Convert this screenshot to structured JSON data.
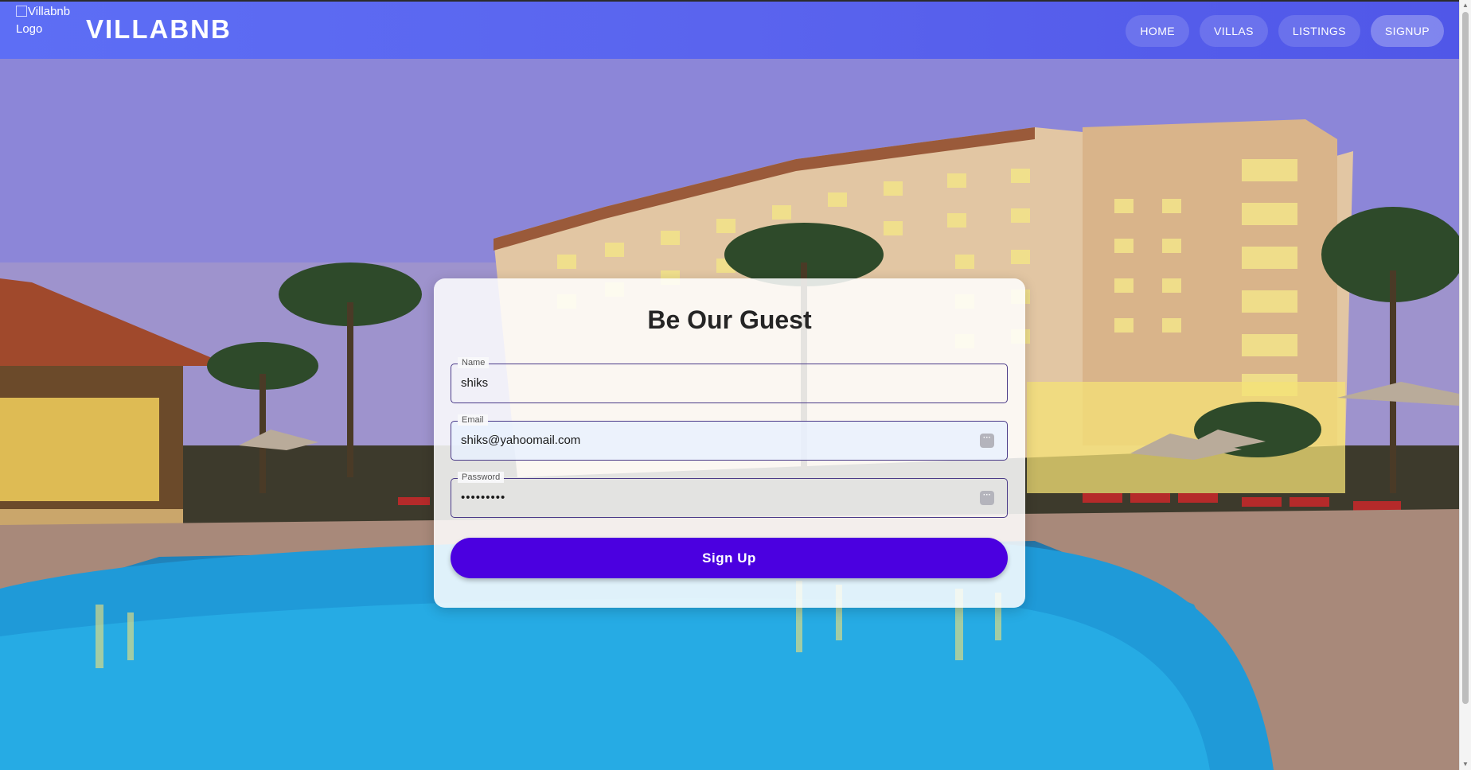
{
  "navbar": {
    "logo_alt": "Villabnb Logo",
    "brand": "VILLABNB",
    "links": [
      {
        "label": "HOME"
      },
      {
        "label": "VILLAS"
      },
      {
        "label": "LISTINGS"
      },
      {
        "label": "SIGNUP",
        "active": true
      }
    ]
  },
  "form": {
    "title": "Be Our Guest",
    "fields": {
      "name": {
        "label": "Name",
        "value": "shiks"
      },
      "email": {
        "label": "Email",
        "value": "shiks@yahoomail.com",
        "icon": "autofill-key-icon"
      },
      "password": {
        "label": "Password",
        "value": "•••••••••",
        "icon": "autofill-key-icon"
      }
    },
    "submit_label": "Sign Up"
  },
  "background": {
    "description_colors": {
      "sky": "#7d7fe0",
      "pool": "#2aa3d8",
      "building": "#e8c9a0"
    }
  },
  "colors": {
    "navbar": "#5a64ee",
    "submit": "#4b00e0",
    "field_border": "#4a3a88"
  }
}
